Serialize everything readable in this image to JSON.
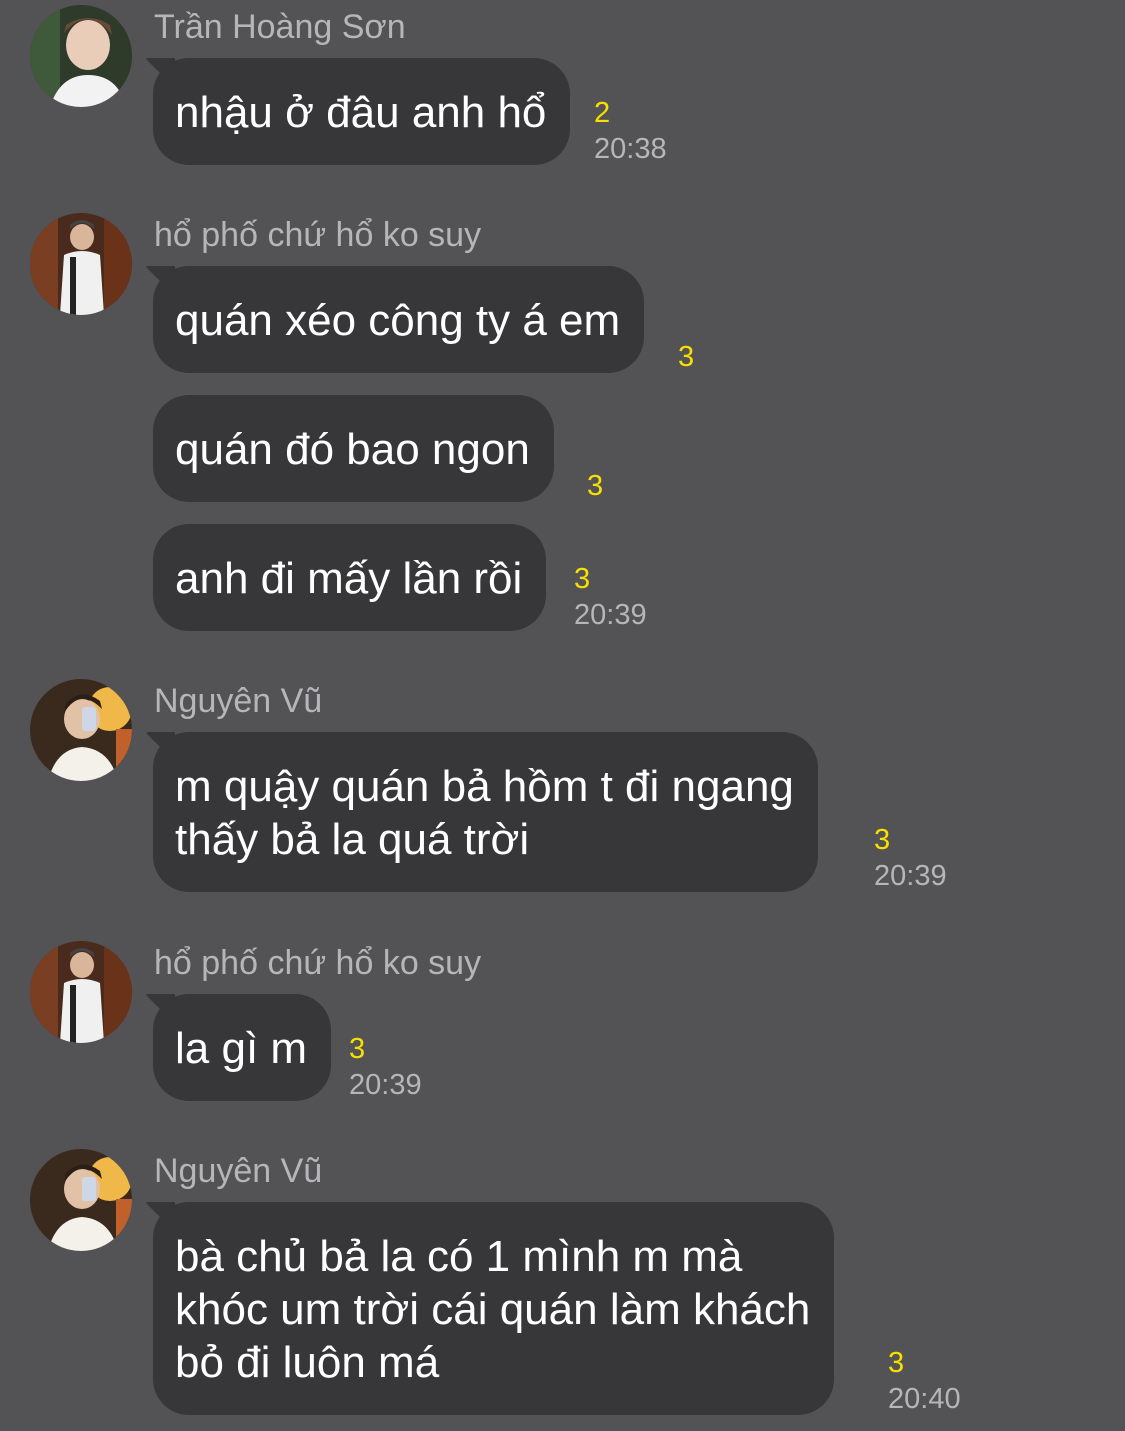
{
  "conversation": [
    {
      "sender": "Trần Hoàng Sơn",
      "avatar": "avatar-tran-hoang-son",
      "messages": [
        {
          "lines": [
            "nhậu ở đâu anh hổ"
          ],
          "read": "2",
          "time": "20:38"
        }
      ]
    },
    {
      "sender": "hổ phố chứ hổ ko suy",
      "avatar": "avatar-ho-pho",
      "messages": [
        {
          "lines": [
            "quán xéo công ty á em"
          ],
          "read": "3",
          "time": ""
        },
        {
          "lines": [
            "quán đó bao ngon"
          ],
          "read": "3",
          "time": ""
        },
        {
          "lines": [
            "anh đi mấy lần rồi"
          ],
          "read": "3",
          "time": "20:39"
        }
      ]
    },
    {
      "sender": "Nguyên Vũ",
      "avatar": "avatar-nguyen-vu",
      "messages": [
        {
          "lines": [
            "m quậy quán bả hồm t đi ngang",
            "thấy bả la quá trời"
          ],
          "read": "3",
          "time": "20:39"
        }
      ]
    },
    {
      "sender": "hổ phố chứ hổ ko suy",
      "avatar": "avatar-ho-pho",
      "messages": [
        {
          "lines": [
            "la gì m"
          ],
          "read": "3",
          "time": "20:39"
        }
      ]
    },
    {
      "sender": "Nguyên Vũ",
      "avatar": "avatar-nguyen-vu",
      "messages": [
        {
          "lines": [
            "bà chủ bả la có 1 mình m mà",
            "khóc um trời cái quán làm khách",
            "bỏ đi luôn má"
          ],
          "read": "3",
          "time": "20:40"
        }
      ]
    }
  ],
  "colors": {
    "background": "#535254",
    "bubble": "#373639",
    "text": "#ffffff",
    "meta": "#b6b5b8",
    "read_count": "#f7e000"
  }
}
